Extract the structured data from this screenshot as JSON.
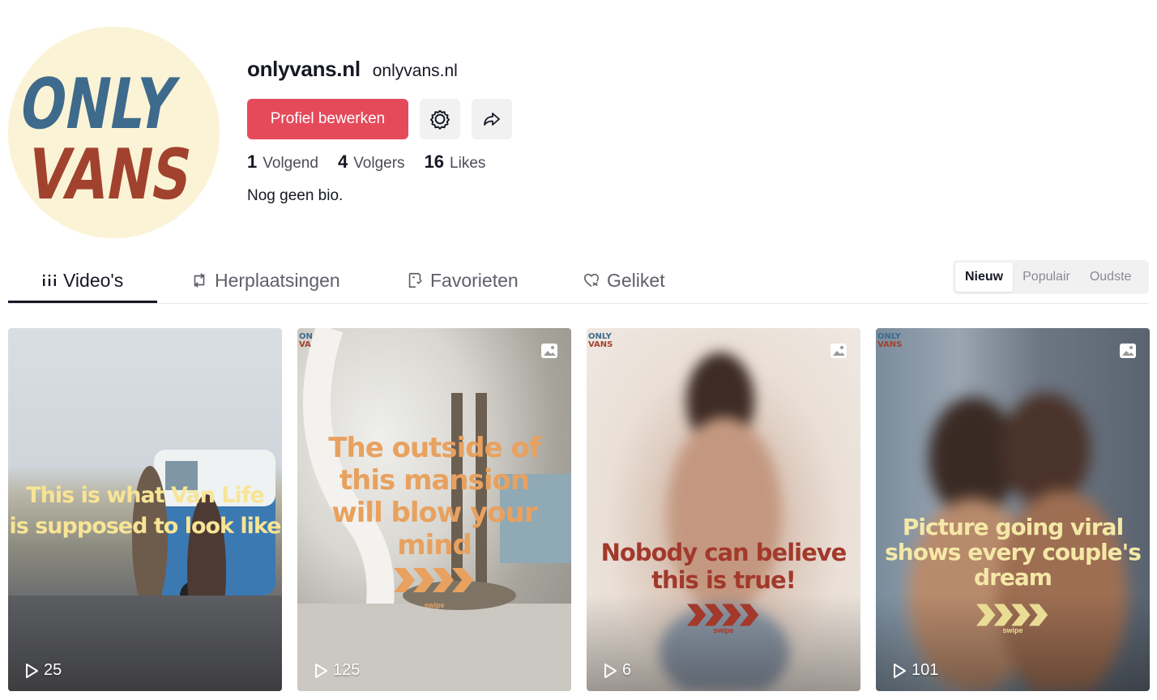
{
  "profile": {
    "username": "onlyvans.nl",
    "nickname": "onlyvans.nl",
    "avatar_logo_line1": "ONLY",
    "avatar_logo_line2": "VANS",
    "edit_button_label": "Profiel bewerken",
    "settings_icon": "gear-icon",
    "share_icon": "share-icon",
    "stats": {
      "following_count": "1",
      "following_label": "Volgend",
      "followers_count": "4",
      "followers_label": "Volgers",
      "likes_count": "16",
      "likes_label": "Likes"
    },
    "bio": "Nog geen bio."
  },
  "tabs": [
    {
      "label": "Video's",
      "icon": "grid-icon",
      "active": true
    },
    {
      "label": "Herplaatsingen",
      "icon": "repost-icon",
      "active": false
    },
    {
      "label": "Favorieten",
      "icon": "bookmark-icon",
      "active": false
    },
    {
      "label": "Geliket",
      "icon": "heart-icon",
      "active": false
    }
  ],
  "sort": [
    {
      "label": "Nieuw",
      "active": true
    },
    {
      "label": "Populair",
      "active": false
    },
    {
      "label": "Oudste",
      "active": false
    }
  ],
  "videos": [
    {
      "caption_line1": "This is what Van Life",
      "caption_line2": "is supposed to look like",
      "views": "25",
      "has_photo_icon": false
    },
    {
      "caption_line1": "The outside of",
      "caption_line2": "this mansion",
      "caption_line3": "will blow your",
      "caption_line4": "mind",
      "swipe": "swipe",
      "views": "125",
      "has_photo_icon": true
    },
    {
      "caption_line1": "Nobody can believe",
      "caption_line2": "this is true!",
      "swipe": "swipe",
      "views": "6",
      "has_photo_icon": true
    },
    {
      "caption_line1": "Picture going viral",
      "caption_line2": "shows every couple's",
      "caption_line3": "dream",
      "swipe": "swipe",
      "views": "101",
      "has_photo_icon": true
    }
  ],
  "colors": {
    "accent": "#e54a5b",
    "logo_blue": "#3e6a8c",
    "logo_red": "#a1422f",
    "avatar_bg": "#fbf3d5"
  }
}
